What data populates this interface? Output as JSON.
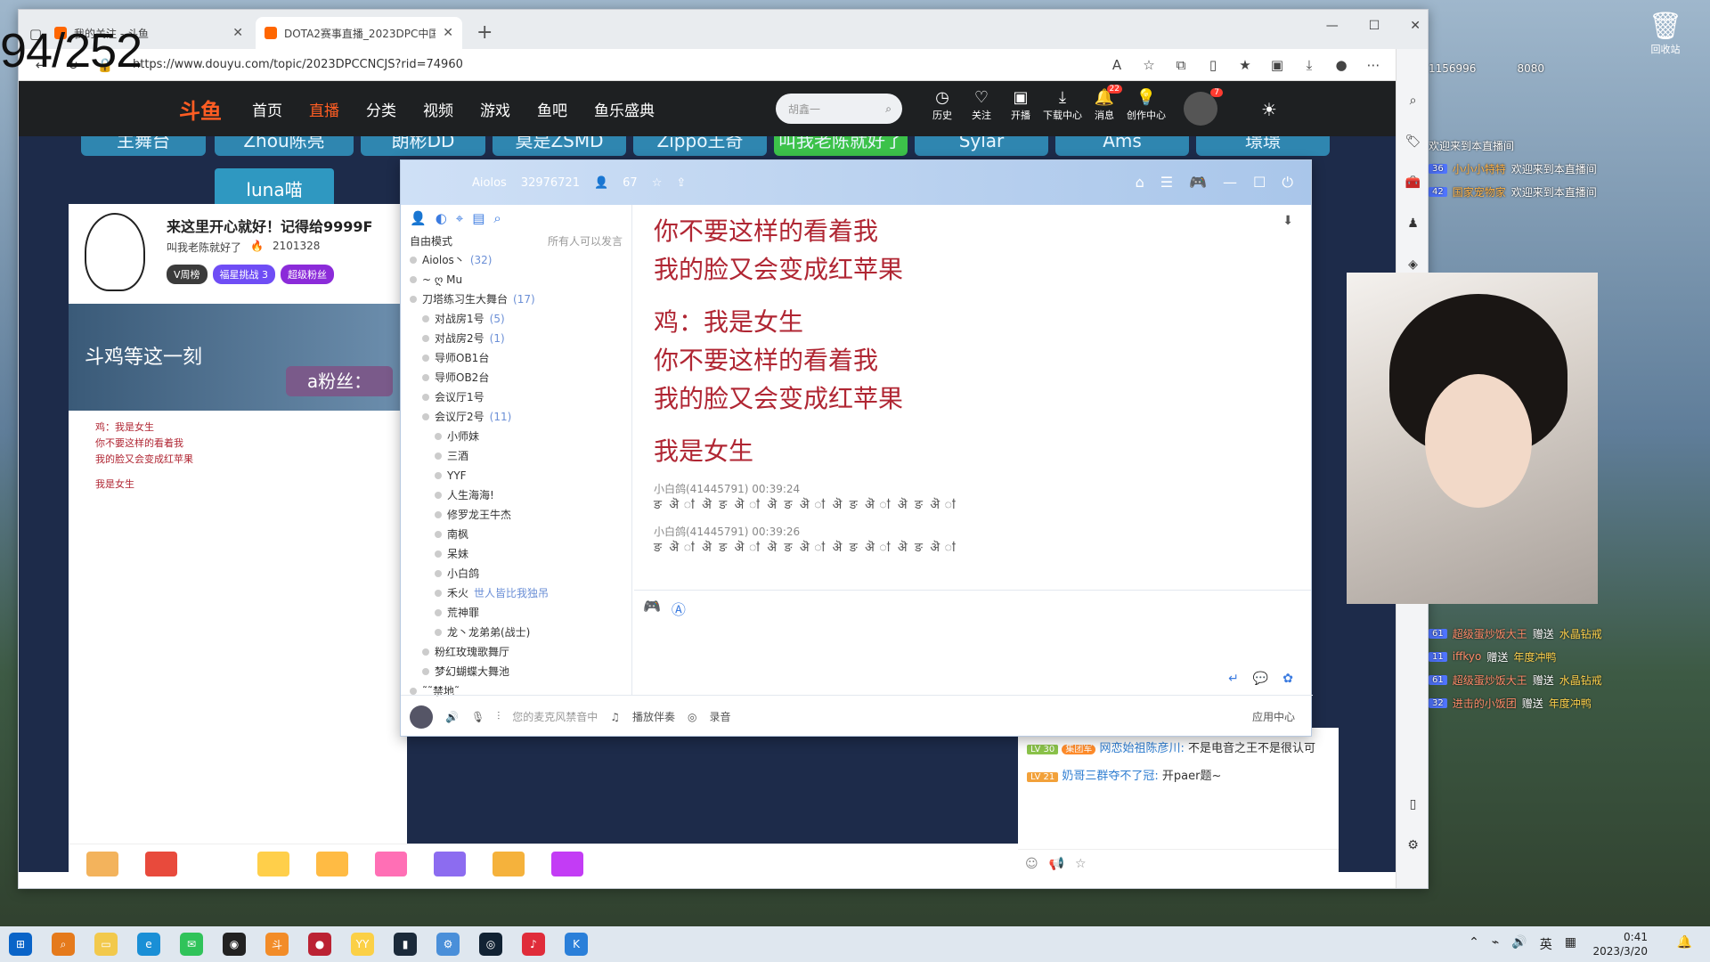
{
  "overlay": {
    "counter": "94/252"
  },
  "desktop": {
    "recycle_bin": "回收站"
  },
  "browser": {
    "tabs": [
      {
        "title": "我的关注 - 斗鱼",
        "active": false
      },
      {
        "title": "DOTA2赛事直播_2023DPC中国联",
        "active": true
      }
    ],
    "url": "https://www.douyu.com/topic/2023DPCCNCJS?rid=74960"
  },
  "douyu": {
    "logo": "斗鱼",
    "nav": [
      "首页",
      "直播",
      "分类",
      "视频",
      "游戏",
      "鱼吧",
      "鱼乐盛典"
    ],
    "active_nav": "直播",
    "search_placeholder": "胡鑫一",
    "icons": [
      {
        "icon": "history-icon",
        "label": "历史"
      },
      {
        "icon": "heart-icon",
        "label": "关注"
      },
      {
        "icon": "broadcast-icon",
        "label": "开播"
      },
      {
        "icon": "download-icon",
        "label": "下载中心"
      },
      {
        "icon": "bell-icon",
        "label": "消息",
        "badge": "22"
      },
      {
        "icon": "bulb-icon",
        "label": "创作中心"
      }
    ],
    "avatar_badge": "7",
    "ribbons": [
      "主舞台",
      "Zhou陈亮",
      "朗彬DD",
      "莫是ZSMD",
      "Zippo王奇",
      "叫我老陈就好了",
      "Sylar",
      "Ams",
      "璟璟"
    ],
    "luna": "luna喵",
    "streamer": {
      "title": "来这里开心就好！记得给9999F",
      "name": "叫我老陈就好了",
      "heat": "2101328",
      "tags": [
        "V周榜",
        "福星挑战 3",
        "超级粉丝"
      ]
    },
    "danmu_overlay": [
      "斗鸡等这一刻",
      "a粉丝："
    ]
  },
  "yy": {
    "channel_name": "Aiolos",
    "channel_id": "32976721",
    "users": "67",
    "mode": "自由模式",
    "mode_right": "所有人可以发言",
    "tree": [
      {
        "label": "Aiolos丶",
        "count": "(32)",
        "level": 0
      },
      {
        "label": "~ ღ Mu",
        "count": "",
        "level": 0
      },
      {
        "label": "刀塔练习生大舞台",
        "count": "(17)",
        "level": 0
      },
      {
        "label": "对战房1号",
        "count": "(5)",
        "level": 1
      },
      {
        "label": "对战房2号",
        "count": "(1)",
        "level": 1
      },
      {
        "label": "导师OB1台",
        "count": "",
        "level": 1
      },
      {
        "label": "导师OB2台",
        "count": "",
        "level": 1
      },
      {
        "label": "会议厅1号",
        "count": "",
        "level": 1
      },
      {
        "label": "会议厅2号",
        "count": "(11)",
        "level": 1
      },
      {
        "label": "小师妹",
        "count": "",
        "level": 2
      },
      {
        "label": "三酒",
        "count": "",
        "level": 2
      },
      {
        "label": "YYF",
        "count": "",
        "level": 2
      },
      {
        "label": "人生海海!",
        "count": "",
        "level": 2
      },
      {
        "label": "修罗龙王牛杰",
        "count": "",
        "level": 2
      },
      {
        "label": "南枫",
        "count": "",
        "level": 2
      },
      {
        "label": "呆妹",
        "count": "",
        "level": 2
      },
      {
        "label": "小白鸽",
        "count": "",
        "level": 2
      },
      {
        "label": "禾火",
        "count": "世人皆比我独吊",
        "level": 2
      },
      {
        "label": "荒神罪",
        "count": "",
        "level": 2
      },
      {
        "label": "龙丶龙弟弟(战士)",
        "count": "",
        "level": 2
      },
      {
        "label": "粉红玫瑰歌舞厅",
        "count": "",
        "level": 1
      },
      {
        "label": "梦幻蝴蝶大舞池",
        "count": "",
        "level": 1
      },
      {
        "label": "˜˜禁地˜",
        "count": "",
        "level": 0
      }
    ],
    "lyrics": [
      "你不要这样的看着我",
      "我的脸又会变成红苹果",
      "",
      "鸡：我是女生",
      "你不要这样的看着我",
      "我的脸又会变成红苹果",
      "",
      "我是女生"
    ],
    "msgs": [
      {
        "user": "小白鸽(41445791)",
        "time": "00:39:24",
        "text": "ङ ऄ ऻ ऄ ङ ऄ ऻ ऄ ङ ऄ ऻ ऄ ङ ऄ ऻ ऄ ङ ऄ ऻ"
      },
      {
        "user": "小白鸽(41445791)",
        "time": "00:39:26",
        "text": "ङ ऄ ऻ ऄ ङ ऄ ऻ ऄ ङ ऄ ऻ ऄ ङ ऄ ऻ ऄ ङ ऄ ऻ"
      }
    ],
    "bottom": {
      "mic": "您的麦克风禁音中",
      "play": "播放伴奏",
      "record": "录音",
      "apps": "应用中心"
    }
  },
  "chat_right": [
    {
      "level": "LV 30",
      "badge": "集团军",
      "user": "网恋始祖陈彦川:",
      "text": "不是电音之王不是很认可"
    },
    {
      "level": "LV 21",
      "user": "奶哥三群夺不了冠:",
      "text": "开paer题~"
    }
  ],
  "desk_chat": [
    {
      "text": "欢迎来到本直播间"
    },
    {
      "level": "36",
      "user": "小小小特特",
      "text": "欢迎来到本直播间"
    },
    {
      "level": "42",
      "user": "国家宠物家",
      "text": "欢迎来到本直播间"
    }
  ],
  "desk_gifts": [
    {
      "level": "61",
      "user": "超级蛋炒饭大王",
      "act": "赠送",
      "gift": "水晶钻戒"
    },
    {
      "level": "11",
      "user": "iffkyo",
      "act": "赠送",
      "gift": "年度冲鸭"
    },
    {
      "level": "61",
      "user": "超级蛋炒饭大王",
      "act": "赠送",
      "gift": "水晶钻戒"
    },
    {
      "level": "32",
      "user": "进击的小饭团",
      "act": "赠送",
      "gift": "年度冲鸭"
    }
  ],
  "desk_stats": {
    "viewers": "1156996",
    "fans": "8080"
  },
  "taskbar": {
    "time": "0:41",
    "date": "2023/3/20",
    "lang": "英"
  },
  "colors": {
    "douyu_orange": "#ff5d23",
    "lyric_red": "#b02633",
    "nav_bg": "#1e2022"
  }
}
